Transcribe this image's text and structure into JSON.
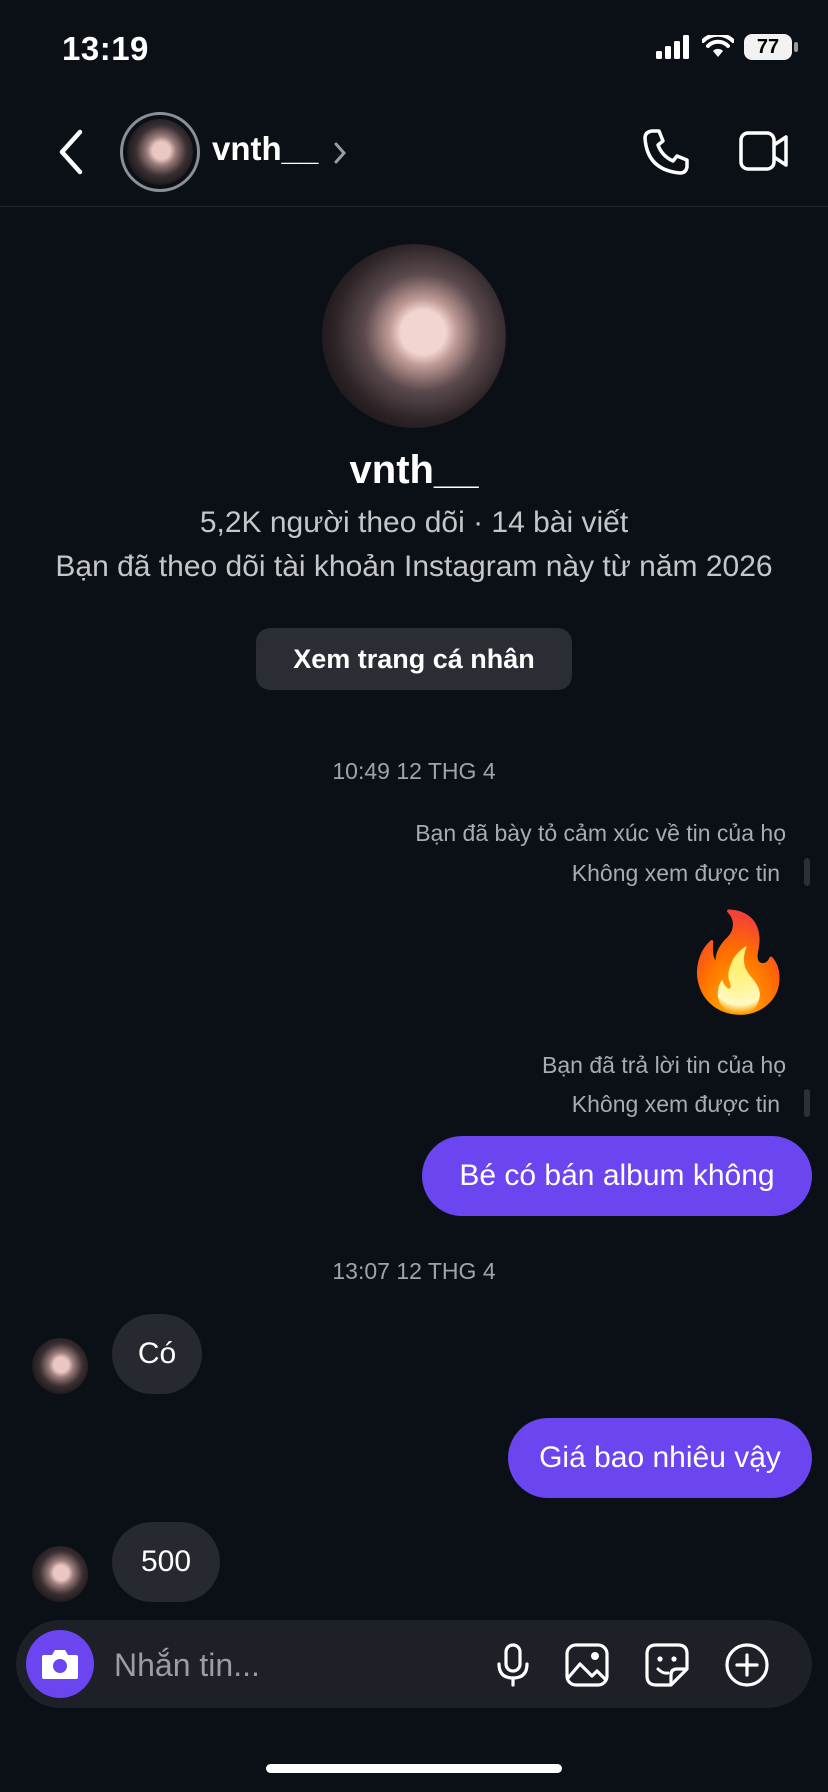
{
  "status_bar": {
    "time": "13:19",
    "battery": "77"
  },
  "header": {
    "username": "vnth__"
  },
  "profile": {
    "name": "vnth__",
    "stats": "5,2K người theo dõi · 14 bài viết",
    "follow_info": "Bạn đã theo dõi tài khoản Instagram này từ năm 2026",
    "view_profile_label": "Xem trang cá nhân"
  },
  "messages": {
    "timestamp_1": "10:49 12 THG 4",
    "reacted_note": "Bạn đã bày tỏ cảm xúc về tin của họ",
    "story_unavailable_1": "Không xem được tin",
    "reaction_emoji": "🔥",
    "replied_note": "Bạn đã trả lời tin của họ",
    "story_unavailable_2": "Không xem được tin",
    "outgoing_1": "Bé có bán album không",
    "timestamp_2": "13:07 12 THG 4",
    "incoming_1": "Có",
    "outgoing_2": "Giá bao nhiêu vậy",
    "incoming_2": "500"
  },
  "composer": {
    "placeholder": "Nhắn tin..."
  },
  "colors": {
    "accent": "#6a45f0",
    "background": "#0b0f16",
    "incoming_bubble": "#262a30"
  },
  "icons": [
    "back-icon",
    "chevron-right-icon",
    "phone-icon",
    "video-camera-icon",
    "camera-icon",
    "microphone-icon",
    "image-icon",
    "sticker-icon",
    "plus-circle-icon"
  ]
}
